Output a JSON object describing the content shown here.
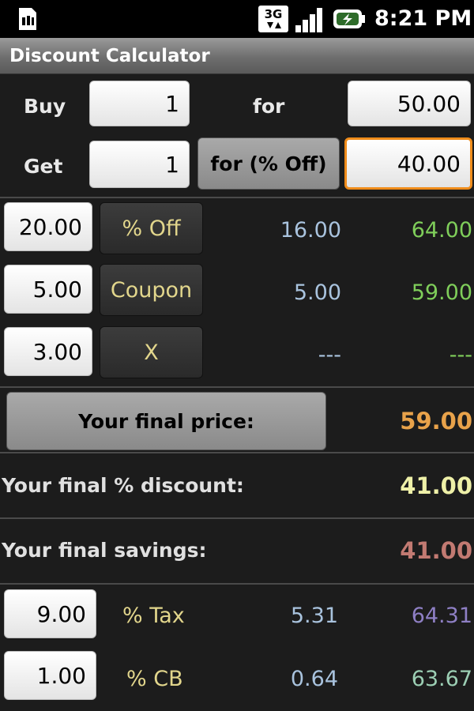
{
  "status": {
    "time": "8:21 PM",
    "network": "3G"
  },
  "app": {
    "title": "Discount Calculator"
  },
  "buy_row": {
    "buy_label": "Buy",
    "buy_qty": "1",
    "for_label": "for",
    "for_price": "50.00"
  },
  "get_row": {
    "get_label": "Get",
    "get_qty": "1",
    "mode_button": "for (% Off)",
    "pct_off": "40.00"
  },
  "discounts": [
    {
      "amount": "20.00",
      "type": "% Off",
      "saving": "16.00",
      "subtotal": "64.00"
    },
    {
      "amount": "5.00",
      "type": "Coupon",
      "saving": "5.00",
      "subtotal": "59.00"
    },
    {
      "amount": "3.00",
      "type": "X",
      "saving": "---",
      "subtotal": "---"
    }
  ],
  "final": {
    "price_button": "Your final price:",
    "price_value": "59.00",
    "discount_label": "Your final % discount:",
    "discount_value": "41.00",
    "savings_label": "Your final savings:",
    "savings_value": "41.00"
  },
  "extras": [
    {
      "amount": "9.00",
      "label": "% Tax",
      "computed": "5.31",
      "total": "64.31"
    },
    {
      "amount": "1.00",
      "label": "% CB",
      "computed": "0.64",
      "total": "63.67"
    }
  ],
  "colors": {
    "accent_focus": "#f08c1a",
    "final_price": "#e8a24a",
    "final_discount": "#eef0a8",
    "final_savings": "#c27a72",
    "subtotal_green": "#7fce5a",
    "tax_total": "#8e7fc4",
    "cb_total": "#9ccfb4",
    "saving_blue": "#a9c3de"
  }
}
